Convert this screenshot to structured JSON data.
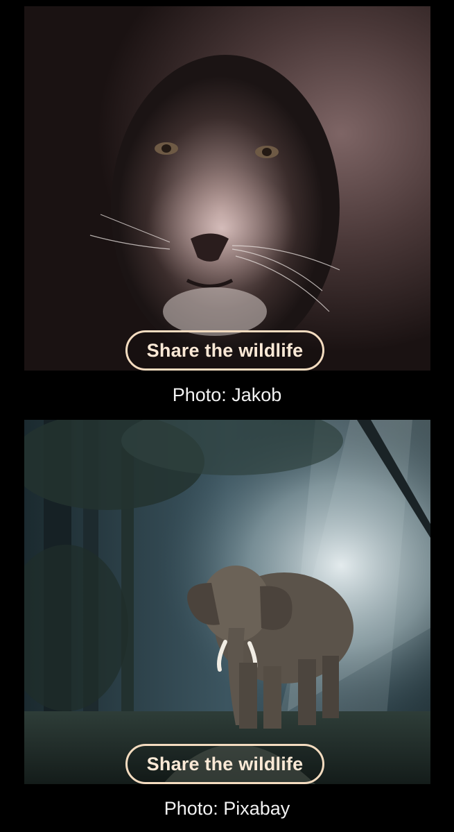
{
  "cards": [
    {
      "subject": "lion",
      "share_label": "Share the wildlife",
      "caption": "Photo: Jakob"
    },
    {
      "subject": "elephant",
      "share_label": "Share the wildlife",
      "caption": "Photo: Pixabay"
    }
  ],
  "colors": {
    "background": "#000000",
    "button_border": "#f4dcc0",
    "button_text": "#fbe9d6",
    "caption_text": "#f2f2f2"
  }
}
